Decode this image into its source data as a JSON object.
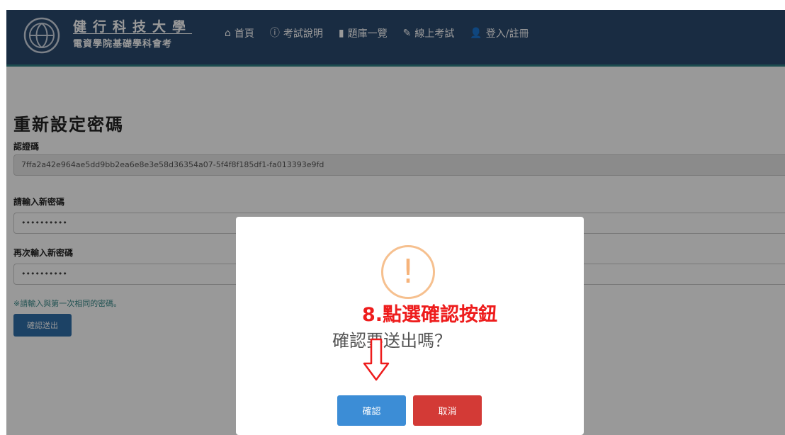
{
  "brand": {
    "title": "健行科技大學",
    "subtitle": "電資學院基礎學科會考"
  },
  "nav": {
    "items": [
      {
        "icon": "home-icon",
        "glyph": "⌂",
        "label": "首頁"
      },
      {
        "icon": "info-icon",
        "glyph": "ⓘ",
        "label": "考試說明"
      },
      {
        "icon": "book-icon",
        "glyph": "▮",
        "label": "題庫一覽"
      },
      {
        "icon": "pencil-icon",
        "glyph": "✎",
        "label": "線上考試"
      },
      {
        "icon": "user-icon",
        "glyph": "👤",
        "label": "登入/註冊"
      }
    ]
  },
  "form": {
    "title": "重新設定密碼",
    "code_label": "認證碼",
    "code_value": "7ffa2a42e964ae5dd9bb2ea6e8e3e58d36354a07-5f4f8f185df1-fa013393e9fd",
    "new_password_label": "請輸入新密碼",
    "new_password_value": "••••••••••",
    "confirm_password_label": "再次輸入新密碼",
    "confirm_password_value": "••••••••••",
    "hint": "※請輸入與第一次相同的密碼。",
    "submit_label": "確認送出"
  },
  "modal": {
    "icon_glyph": "!",
    "annotation": "8.點選確認按鈕",
    "message": "確認要送出嗎？",
    "confirm_label": "確認",
    "cancel_label": "取消"
  },
  "colors": {
    "navbar": "#2b4a6f",
    "confirm_button": "#3c8dd6",
    "cancel_button": "#d33a36",
    "warning": "#f6c08f",
    "annotation": "#ee1c1c"
  }
}
